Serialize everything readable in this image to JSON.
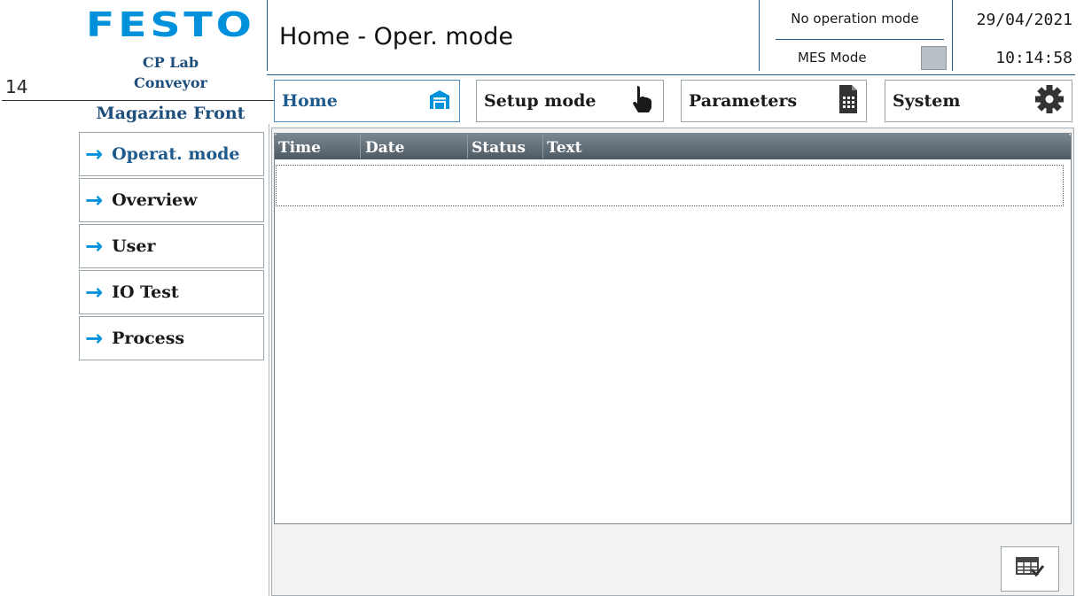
{
  "logo": {
    "brand": "FESTO"
  },
  "station": {
    "line1": "CP Lab",
    "line2": "Conveyor",
    "line3": "Magazine Front"
  },
  "header": {
    "title": "Home - Oper. mode",
    "operation_mode": "No operation mode",
    "mes_label": "MES Mode",
    "date": "29/04/2021",
    "time": "10:14:58"
  },
  "annotation": {
    "number": "14"
  },
  "top_nav": [
    {
      "label": "Home",
      "icon": "home-icon",
      "active": true
    },
    {
      "label": "Setup mode",
      "icon": "hand-pointer-icon"
    },
    {
      "label": "Parameters",
      "icon": "document-table-icon"
    },
    {
      "label": "System",
      "icon": "gear-icon"
    }
  ],
  "side_nav": [
    {
      "label": "Operat. mode",
      "active": true
    },
    {
      "label": "Overview"
    },
    {
      "label": "User"
    },
    {
      "label": "IO Test"
    },
    {
      "label": "Process"
    }
  ],
  "alarm_table": {
    "columns": [
      "Time",
      "Date",
      "Status",
      "Text"
    ],
    "rows": []
  },
  "colors": {
    "brand_blue": "#0091dc",
    "station_text": "#1e4e7c",
    "grid_header": "#5a6670"
  }
}
